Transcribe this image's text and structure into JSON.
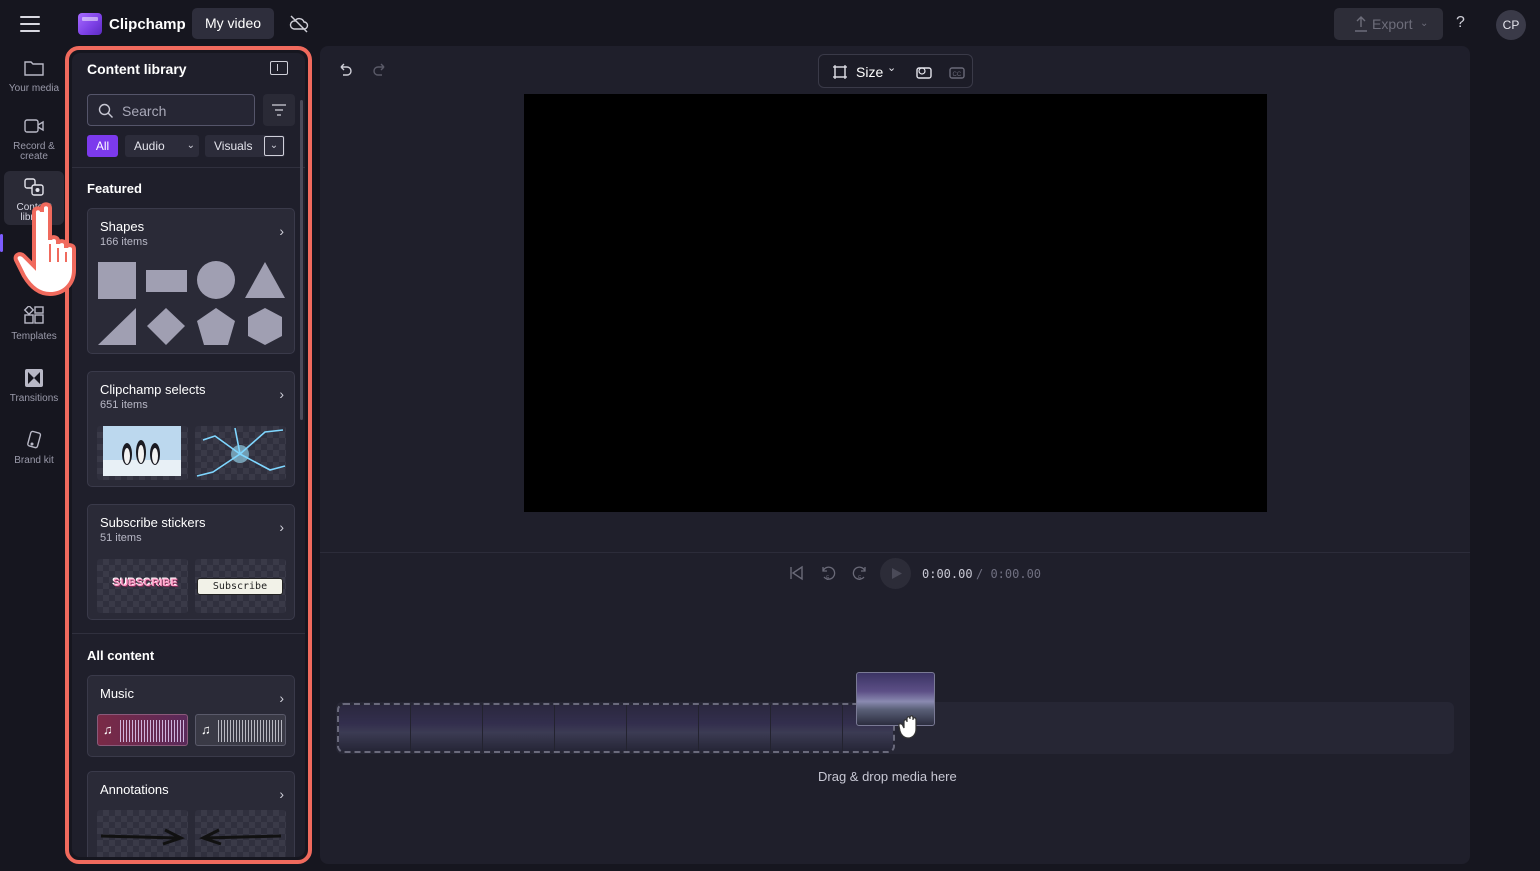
{
  "app": {
    "name": "Clipchamp",
    "project_title": "My video",
    "export_label": "Export",
    "help_label": "?",
    "avatar_initials": "CP",
    "accent_color": "#7c3aed",
    "highlight_color": "#f06a5d"
  },
  "sidebar": {
    "items": [
      {
        "label": "Your media",
        "icon": "folder-icon"
      },
      {
        "label": "Record & create",
        "icon": "video-camera-icon"
      },
      {
        "label": "Content library",
        "icon": "content-library-icon",
        "active": true
      },
      {
        "label": "Templates",
        "icon": "templates-icon"
      },
      {
        "label": "Transitions",
        "icon": "transitions-icon"
      },
      {
        "label": "Brand kit",
        "icon": "brand-kit-icon"
      }
    ]
  },
  "library": {
    "title": "Content library",
    "search_placeholder": "Search",
    "filters": {
      "all": "All",
      "audio": "Audio",
      "visuals": "Visuals"
    },
    "featured_heading": "Featured",
    "all_content_heading": "All content",
    "featured": [
      {
        "title": "Shapes",
        "count": "166 items"
      },
      {
        "title": "Clipchamp selects",
        "count": "651 items"
      },
      {
        "title": "Subscribe stickers",
        "count": "51 items"
      }
    ],
    "all_content": [
      {
        "title": "Music"
      },
      {
        "title": "Annotations"
      }
    ],
    "sticker_text_1": "SUBSCRIBE",
    "sticker_text_2": "Subscribe"
  },
  "preview": {
    "size_label": "Size",
    "time_current": "0:00.00",
    "time_total": "/ 0:00.00",
    "skip_label": "5"
  },
  "timeline": {
    "drop_text": "Drag & drop media here"
  }
}
